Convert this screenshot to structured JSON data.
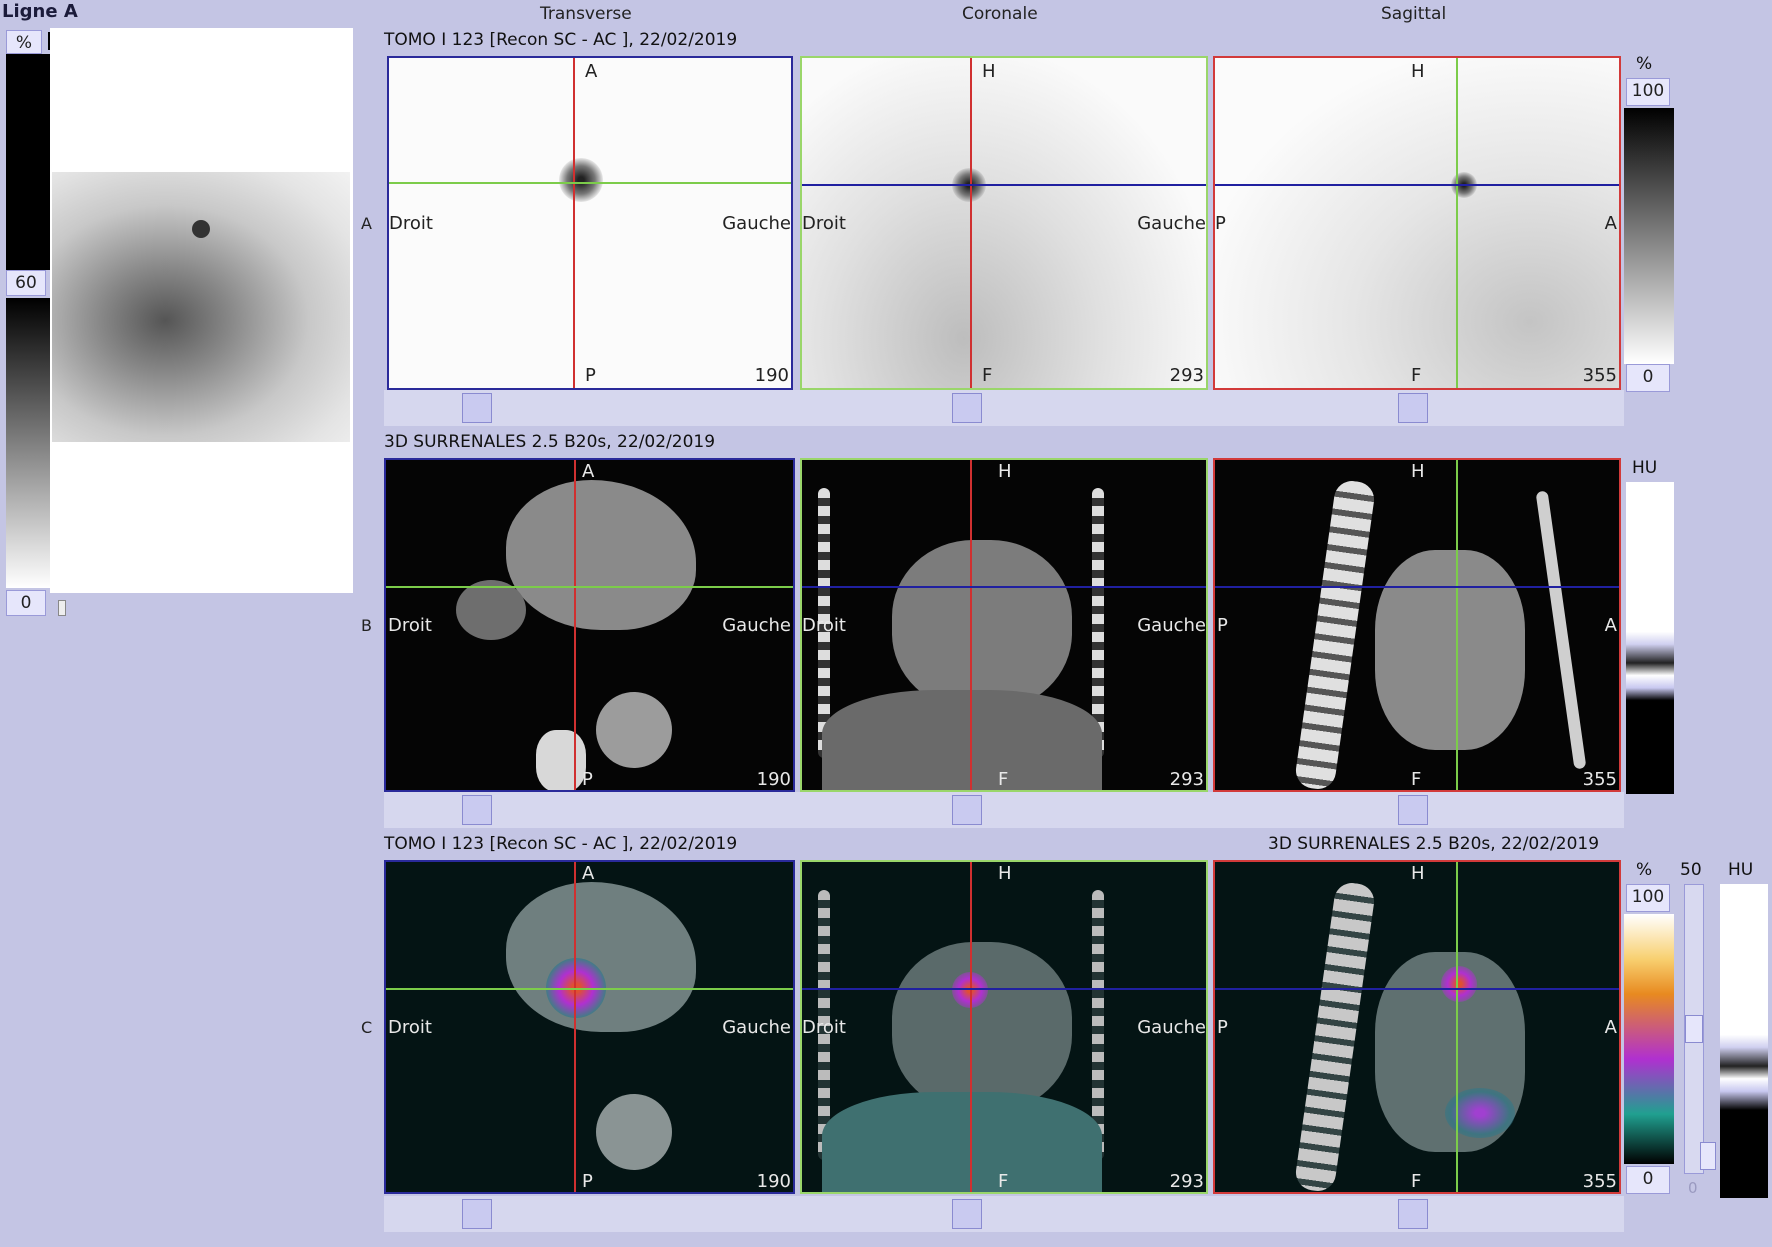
{
  "panel_title": "Ligne A",
  "left_panel": {
    "percent_label": "%",
    "frame_badge": "1",
    "level_top": "60",
    "level_bottom": "0"
  },
  "columns": {
    "col1": "Transverse",
    "col2": "Coronale",
    "col3": "Sagittal"
  },
  "rows": {
    "a": {
      "label": "A",
      "series": "TOMO I 123 [Recon SC - AC ], 22/02/2019",
      "percent_label": "%",
      "scale_max": "100",
      "scale_min": "0",
      "views": [
        {
          "top": "A",
          "bottom": "P",
          "left": "Droit",
          "right": "Gauche",
          "slice": "190"
        },
        {
          "top": "H",
          "bottom": "F",
          "left": "Droit",
          "right": "Gauche",
          "slice": "293"
        },
        {
          "top": "H",
          "bottom": "F",
          "left": "P",
          "right": "A",
          "slice": "355"
        }
      ]
    },
    "b": {
      "label": "B",
      "series": "3D SURRENALES  2.5  B20s, 22/02/2019",
      "unit": "HU",
      "views": [
        {
          "top": "A",
          "bottom": "P",
          "left": "Droit",
          "right": "Gauche",
          "slice": "190"
        },
        {
          "top": "H",
          "bottom": "F",
          "left": "Droit",
          "right": "Gauche",
          "slice": "293"
        },
        {
          "top": "H",
          "bottom": "F",
          "left": "P",
          "right": "A",
          "slice": "355"
        }
      ]
    },
    "c": {
      "label": "C",
      "series_left": "TOMO I 123 [Recon SC - AC ], 22/02/2019",
      "series_right": "3D SURRENALES  2.5  B20s, 22/02/2019",
      "percent_label": "%",
      "blend_value": "50",
      "unit": "HU",
      "scale_max": "100",
      "scale_min": "0",
      "blend_min": "0",
      "views": [
        {
          "top": "A",
          "bottom": "P",
          "left": "Droit",
          "right": "Gauche",
          "slice": "190"
        },
        {
          "top": "H",
          "bottom": "F",
          "left": "Droit",
          "right": "Gauche",
          "slice": "293"
        },
        {
          "top": "H",
          "bottom": "F",
          "left": "P",
          "right": "A",
          "slice": "355"
        }
      ]
    }
  },
  "colors": {
    "background": "#c4c5e4",
    "transverse_frame": "#2a2a9a",
    "coronal_frame": "#9ad66a",
    "sagittal_frame": "#d23a3a",
    "crosshair_red": "#d03030",
    "crosshair_green": "#7ccc4a",
    "crosshair_blue": "#2020a0"
  }
}
